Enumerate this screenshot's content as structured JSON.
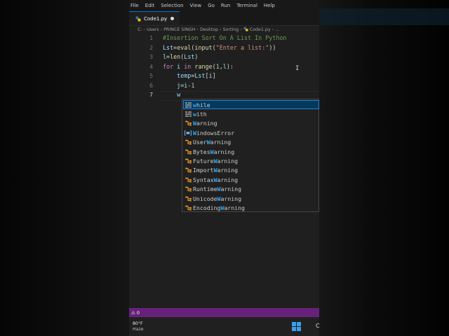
{
  "menubar": {
    "items": [
      "File",
      "Edit",
      "Selection",
      "View",
      "Go",
      "Run",
      "Terminal",
      "Help"
    ]
  },
  "tab": {
    "label": "Code1.py"
  },
  "breadcrumb": {
    "parts": [
      "C:",
      "Users",
      "PRINCE SINGH",
      "Desktop",
      "Sorting",
      "Code1.py",
      "..."
    ]
  },
  "editor": {
    "line_numbers": [
      "1",
      "2",
      "3",
      "4",
      "5",
      "6",
      "7"
    ],
    "lines": [
      [
        {
          "t": "#Insertion Sort On A List In Python",
          "c": "cm"
        }
      ],
      [
        {
          "t": "Lst",
          "c": "vr"
        },
        {
          "t": "=",
          "c": "op"
        },
        {
          "t": "eval",
          "c": "fn"
        },
        {
          "t": "(",
          "c": "op"
        },
        {
          "t": "input",
          "c": "fn"
        },
        {
          "t": "(",
          "c": "op"
        },
        {
          "t": "\"Enter a list:\"",
          "c": "st"
        },
        {
          "t": "))",
          "c": "op"
        }
      ],
      [
        {
          "t": "l",
          "c": "vr"
        },
        {
          "t": "=",
          "c": "op"
        },
        {
          "t": "len",
          "c": "fn"
        },
        {
          "t": "(",
          "c": "op"
        },
        {
          "t": "Lst",
          "c": "vr"
        },
        {
          "t": ")",
          "c": "op"
        }
      ],
      [
        {
          "t": "for ",
          "c": "kw"
        },
        {
          "t": "i ",
          "c": "vr"
        },
        {
          "t": "in ",
          "c": "kw"
        },
        {
          "t": "range",
          "c": "fn"
        },
        {
          "t": "(",
          "c": "op"
        },
        {
          "t": "1",
          "c": "nm"
        },
        {
          "t": ",",
          "c": "op"
        },
        {
          "t": "l",
          "c": "vr"
        },
        {
          "t": "):",
          "c": "op"
        }
      ],
      [
        {
          "t": "    ",
          "c": "op"
        },
        {
          "t": "temp",
          "c": "vr"
        },
        {
          "t": "=",
          "c": "op"
        },
        {
          "t": "Lst",
          "c": "vr"
        },
        {
          "t": "[",
          "c": "op"
        },
        {
          "t": "i",
          "c": "vr"
        },
        {
          "t": "]",
          "c": "op"
        }
      ],
      [
        {
          "t": "    ",
          "c": "op"
        },
        {
          "t": "j",
          "c": "vr"
        },
        {
          "t": "=",
          "c": "op"
        },
        {
          "t": "i",
          "c": "vr"
        },
        {
          "t": "-",
          "c": "op"
        },
        {
          "t": "1",
          "c": "nm"
        }
      ],
      [
        {
          "t": "    ",
          "c": "op"
        },
        {
          "t": "w",
          "c": "vr"
        }
      ]
    ]
  },
  "suggestions": [
    {
      "pre": "",
      "hl": "w",
      "post": "hile",
      "icon": "keyword",
      "selected": true
    },
    {
      "pre": "",
      "hl": "w",
      "post": "ith",
      "icon": "keyword",
      "selected": false
    },
    {
      "pre": "",
      "hl": "W",
      "post": "arning",
      "icon": "class",
      "selected": false
    },
    {
      "pre": "",
      "hl": "W",
      "post": "indowsError",
      "icon": "variable",
      "selected": false
    },
    {
      "pre": "User",
      "hl": "W",
      "post": "arning",
      "icon": "class",
      "selected": false
    },
    {
      "pre": "Bytes",
      "hl": "W",
      "post": "arning",
      "icon": "class",
      "selected": false
    },
    {
      "pre": "Future",
      "hl": "W",
      "post": "arning",
      "icon": "class",
      "selected": false
    },
    {
      "pre": "Import",
      "hl": "W",
      "post": "arning",
      "icon": "class",
      "selected": false
    },
    {
      "pre": "Syntax",
      "hl": "W",
      "post": "arning",
      "icon": "class",
      "selected": false
    },
    {
      "pre": "Runtime",
      "hl": "W",
      "post": "arning",
      "icon": "class",
      "selected": false
    },
    {
      "pre": "Unicode",
      "hl": "W",
      "post": "arning",
      "icon": "class",
      "selected": false
    },
    {
      "pre": "Encoding",
      "hl": "W",
      "post": "arning",
      "icon": "class",
      "selected": false
    }
  ],
  "statusbar": {
    "problems": "0"
  },
  "taskbar": {
    "temp": "80°F",
    "condition": "Haze",
    "letter": "C"
  },
  "colors": {
    "statusbar": "#68217a",
    "selection": "#04395e",
    "match": "#2aaaff",
    "class_icon": "#ee9d28",
    "keyword_icon": "#cccccc"
  }
}
